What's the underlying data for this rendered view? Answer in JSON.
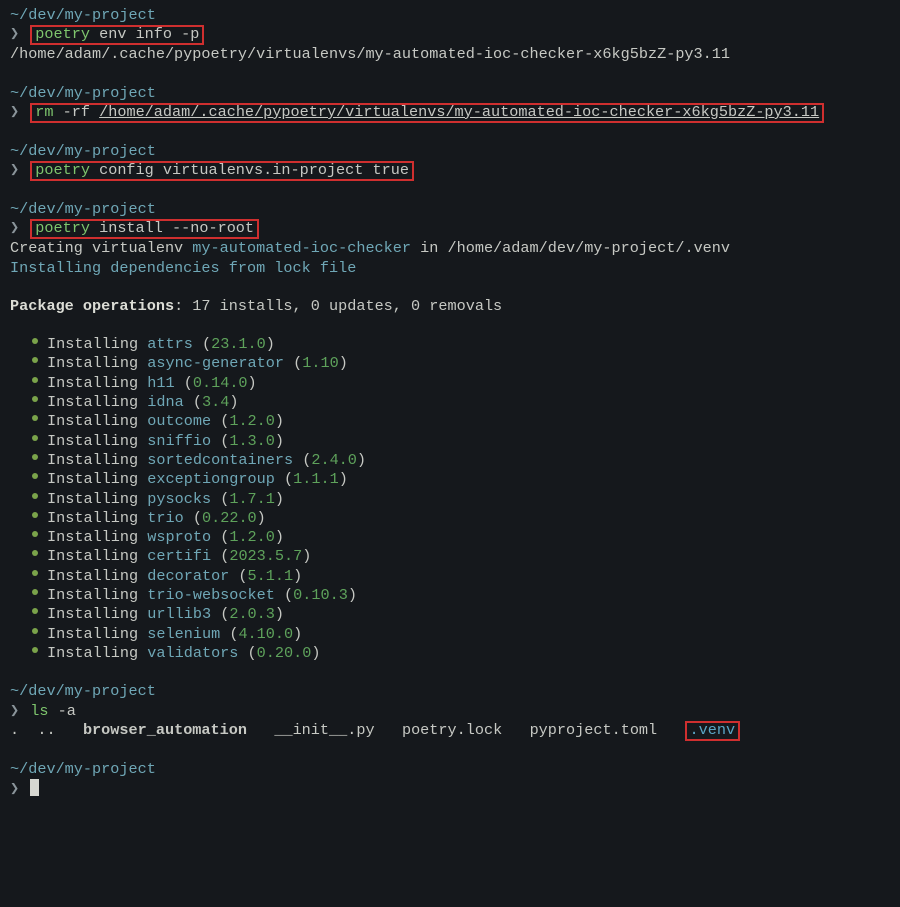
{
  "cwd": "~/dev/my-project",
  "prompt": "❯",
  "blocks": {
    "envinfo": {
      "cmd": "poetry",
      "args": "env info -p",
      "out": "/home/adam/.cache/pypoetry/virtualenvs/my-automated-ioc-checker-x6kg5bzZ-py3.11"
    },
    "rm": {
      "cmd": "rm",
      "flags": "-rf",
      "path": "/home/adam/.cache/pypoetry/virtualenvs/my-automated-ioc-checker-x6kg5bzZ-py3.11"
    },
    "config": {
      "cmd": "poetry",
      "args": "config virtualenvs.in-project true"
    },
    "install": {
      "cmd": "poetry",
      "args": "install --no-root",
      "creating_pre": "Creating virtualenv ",
      "venvname": "my-automated-ioc-checker",
      "creating_in": " in /home/adam/dev/my-project/.venv",
      "dep_line": "Installing dependencies from lock file",
      "ops_head": "Package operations",
      "ops_rest": ": 17 installs, 0 updates, 0 removals"
    },
    "ls": {
      "cmd": "ls",
      "args": "-a",
      "dot": ".",
      "ddot": "..",
      "dir": "browser_automation",
      "init": "__init__.py",
      "lock": "poetry.lock",
      "pyproj": "pyproject.toml",
      "venv": ".venv"
    }
  },
  "install_word": "Installing",
  "packages": [
    {
      "name": "attrs",
      "ver": "23.1.0"
    },
    {
      "name": "async-generator",
      "ver": "1.10"
    },
    {
      "name": "h11",
      "ver": "0.14.0"
    },
    {
      "name": "idna",
      "ver": "3.4"
    },
    {
      "name": "outcome",
      "ver": "1.2.0"
    },
    {
      "name": "sniffio",
      "ver": "1.3.0"
    },
    {
      "name": "sortedcontainers",
      "ver": "2.4.0"
    },
    {
      "name": "exceptiongroup",
      "ver": "1.1.1"
    },
    {
      "name": "pysocks",
      "ver": "1.7.1"
    },
    {
      "name": "trio",
      "ver": "0.22.0"
    },
    {
      "name": "wsproto",
      "ver": "1.2.0"
    },
    {
      "name": "certifi",
      "ver": "2023.5.7"
    },
    {
      "name": "decorator",
      "ver": "5.1.1"
    },
    {
      "name": "trio-websocket",
      "ver": "0.10.3"
    },
    {
      "name": "urllib3",
      "ver": "2.0.3"
    },
    {
      "name": "selenium",
      "ver": "4.10.0"
    },
    {
      "name": "validators",
      "ver": "0.20.0"
    }
  ]
}
